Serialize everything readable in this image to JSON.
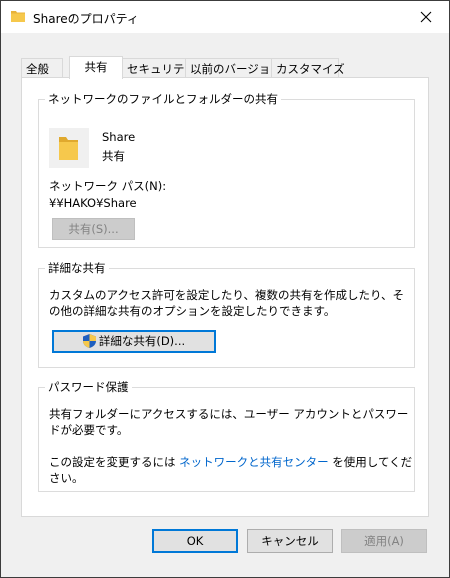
{
  "window": {
    "title": "Shareのプロパティ"
  },
  "tabs": [
    {
      "label": "全般"
    },
    {
      "label": "共有"
    },
    {
      "label": "セキュリティ"
    },
    {
      "label": "以前のバージョン"
    },
    {
      "label": "カスタマイズ"
    }
  ],
  "network_sharing": {
    "group_title": "ネットワークのファイルとフォルダーの共有",
    "share_name": "Share",
    "share_status": "共有",
    "network_path_label": "ネットワーク パス(N):",
    "network_path_value": "¥¥HAKO¥Share",
    "share_button": "共有(S)..."
  },
  "advanced_sharing": {
    "group_title": "詳細な共有",
    "description": "カスタムのアクセス許可を設定したり、複数の共有を作成したり、その他の詳細な共有のオプションを設定したりできます。",
    "button": "詳細な共有(D)..."
  },
  "password_protection": {
    "group_title": "パスワード保護",
    "description": "共有フォルダーにアクセスするには、ユーザー アカウントとパスワードが必要です。",
    "link_prefix": "この設定を変更するには ",
    "link_text": "ネットワークと共有センター",
    "link_suffix": " を使用してください。"
  },
  "footer": {
    "ok": "OK",
    "cancel": "キャンセル",
    "apply": "適用(A)"
  },
  "icons": {
    "folder": "folder-icon",
    "close": "close-icon",
    "shield": "uac-shield-icon"
  },
  "colors": {
    "link": "#0066cc",
    "accent": "#0078d7",
    "folder": "#f5c242"
  }
}
